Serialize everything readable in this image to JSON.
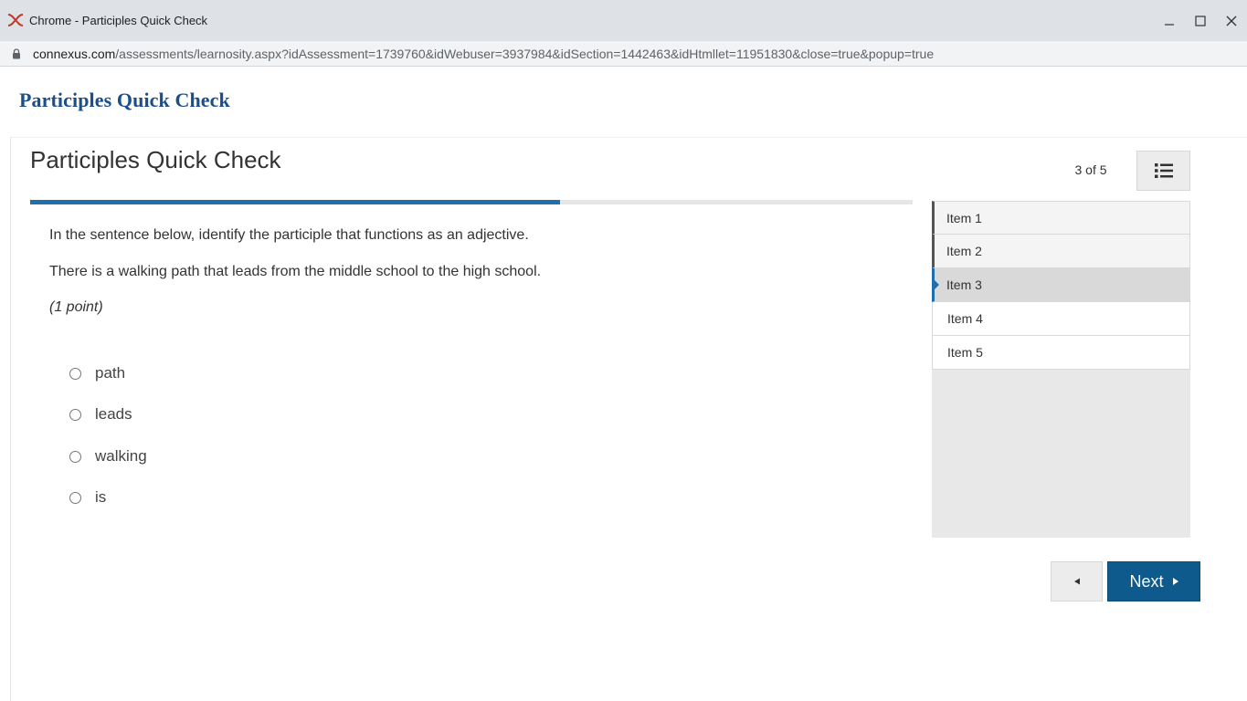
{
  "window": {
    "title": "Chrome - Participles Quick Check",
    "url_host": "connexus.com",
    "url_path": "/assessments/learnosity.aspx?idAssessment=1739760&idWebuser=3937984&idSection=1442463&idHtmllet=11951830&close=true&popup=true"
  },
  "page": {
    "header": "Participles Quick Check"
  },
  "assessment": {
    "title": "Participles Quick Check",
    "counter": "3 of 5",
    "progress_percent": 60
  },
  "question": {
    "instruction": "In the sentence below, identify the participle that functions as an adjective.",
    "sentence": "There is a walking path that leads from the middle school to the high school.",
    "points": "(1 point)",
    "options": [
      {
        "label": "path"
      },
      {
        "label": "leads"
      },
      {
        "label": "walking"
      },
      {
        "label": "is"
      }
    ]
  },
  "items": [
    {
      "label": "Item 1",
      "state": "visited"
    },
    {
      "label": "Item 2",
      "state": "visited"
    },
    {
      "label": "Item 3",
      "state": "current"
    },
    {
      "label": "Item 4",
      "state": "unvisited"
    },
    {
      "label": "Item 5",
      "state": "unvisited"
    }
  ],
  "nav": {
    "next_label": "Next"
  },
  "colors": {
    "brand_blue": "#1a4f8b",
    "progress": "#1f6fad",
    "next_button": "#0f5a8c"
  }
}
